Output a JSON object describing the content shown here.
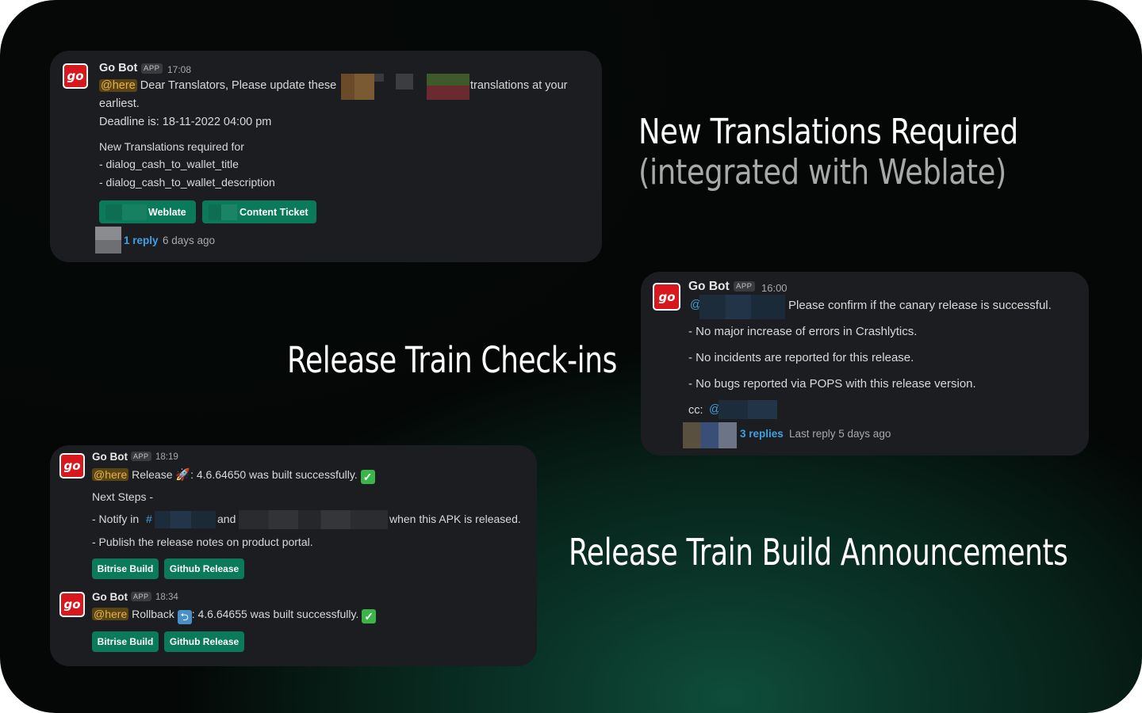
{
  "colors": {
    "card_bg": "#1c1d20",
    "button_bg": "#0a7a5a",
    "mention": "#3fa2e0",
    "here_bg": "#5b4414",
    "here_text": "#e6b24c",
    "brand_logo": "#d7191f"
  },
  "headings": {
    "translations_title": "New Translations Required",
    "translations_sub": "(integrated with Weblate)",
    "checkins": "Release Train Check-ins",
    "announcements": "Release Train Build Announcements"
  },
  "card1": {
    "bot_name": "Go Bot",
    "app_badge": "APP",
    "time": "17:08",
    "here": "@here",
    "line1_a": "Dear Translators, Please update these",
    "line1_b": "translations at your",
    "line2": "earliest.",
    "deadline": "Deadline is: 18-11-2022 04:00 pm",
    "req_title": "New Translations required for",
    "req_items": [
      "- dialog_cash_to_wallet_title",
      "- dialog_cash_to_wallet_description"
    ],
    "buttons": [
      "Weblate",
      "Content Ticket"
    ],
    "reply_link": "1 reply",
    "reply_time": "6 days ago",
    "icon": "go-logo-icon"
  },
  "card2": {
    "bot_name": "Go Bot",
    "app_badge": "APP",
    "time": "16:00",
    "mention": "@",
    "line1": "Please confirm if the canary release is successful.",
    "items": [
      "- No major increase of errors in Crashlytics.",
      "- No incidents are reported for this release.",
      "- No bugs reported via POPS with this release version."
    ],
    "cc_label": "cc:",
    "cc_mention": "@",
    "reply_link": "3 replies",
    "reply_time": "Last reply 5 days ago",
    "icon": "go-logo-icon"
  },
  "card3": {
    "msg1": {
      "bot_name": "Go Bot",
      "app_badge": "APP",
      "time": "18:19",
      "here": "@here",
      "release_word": "Release",
      "build_text": ": 4.6.64650 was built successfully.",
      "next_steps": "Next Steps -",
      "notify_a": "- Notify in",
      "channel_hash": "#",
      "notify_and": "and",
      "notify_b": "when this APK is released.",
      "publish": "- Publish the release notes on product portal.",
      "buttons": [
        "Bitrise Build",
        "Github Release"
      ],
      "icons": [
        "rocket-icon",
        "check-mark-icon"
      ]
    },
    "msg2": {
      "bot_name": "Go Bot",
      "app_badge": "APP",
      "time": "18:34",
      "here": "@here",
      "rollback_word": "Rollback",
      "build_text": ": 4.6.64655 was built successfully.",
      "buttons": [
        "Bitrise Build",
        "Github Release"
      ],
      "icons": [
        "rollback-icon",
        "check-mark-icon"
      ]
    }
  }
}
